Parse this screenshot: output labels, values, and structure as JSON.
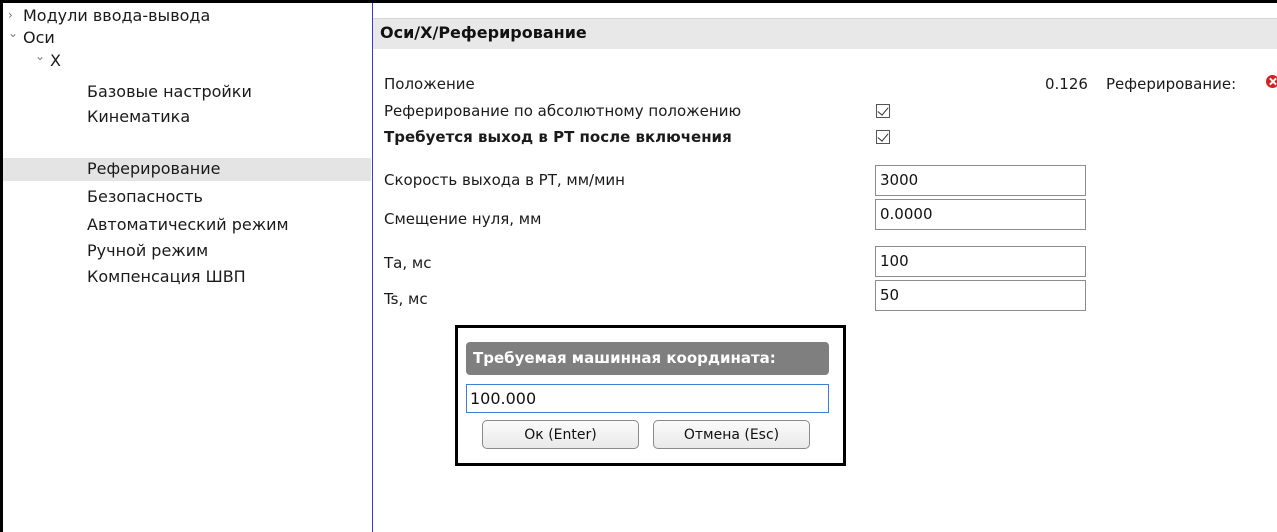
{
  "tree": {
    "items": [
      {
        "label": "Модули ввода-вывода",
        "arrow": "›"
      },
      {
        "label": "Оси",
        "arrow": "⌄"
      },
      {
        "label": "X",
        "arrow": "⌄"
      },
      {
        "label": "Базовые настройки"
      },
      {
        "label": "Кинематика"
      },
      {
        "label": "Реферирование"
      },
      {
        "label": "Безопасность"
      },
      {
        "label": "Автоматический режим"
      },
      {
        "label": "Ручной режим"
      },
      {
        "label": "Компенсация ШВП"
      }
    ],
    "selected_index": 5
  },
  "panel": {
    "title": "Оси/X/Реферирование",
    "position_label": "Положение",
    "position_value": "0.126",
    "ref_label": "Реферирование:",
    "ref_status_icon": "error-icon",
    "abs_ref_label": "Реферирование по абсолютному положению",
    "abs_ref_checked": true,
    "need_rt_label": "Требуется выход в РТ после включения",
    "need_rt_checked": true,
    "rt_speed_label": "Скорость выхода в РТ, мм/мин",
    "rt_speed_value": "3000",
    "zero_offset_label": "Смещение нуля, мм",
    "zero_offset_value": "0.0000",
    "ta_label": "Та, мс",
    "ta_value": "100",
    "ts_label": "Ts, мс",
    "ts_value": "50"
  },
  "dialog": {
    "title": "Требуемая машинная координата:",
    "input_value": "100.000",
    "ok_label": "Ок (Enter)",
    "cancel_label": "Отмена (Esc)"
  },
  "colors": {
    "selected_row": "#e4e4e4",
    "header_bg": "#e8e8e8",
    "dialog_header_bg": "#7f7f7f",
    "error_icon": "#d42020",
    "tree_divider": "#3a3ad0"
  }
}
